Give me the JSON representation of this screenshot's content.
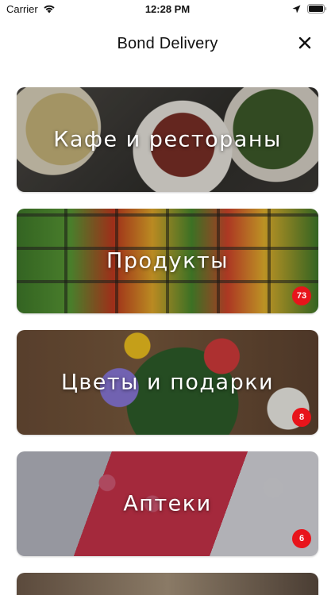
{
  "status_bar": {
    "carrier": "Carrier",
    "time": "12:28 PM"
  },
  "header": {
    "title": "Bond Delivery"
  },
  "categories": [
    {
      "label": "Кафе и рестораны",
      "badge": null
    },
    {
      "label": "Продукты",
      "badge": "73"
    },
    {
      "label": "Цветы и подарки",
      "badge": "8"
    },
    {
      "label": "Аптеки",
      "badge": "6"
    },
    {
      "label": "",
      "badge": null
    }
  ],
  "colors": {
    "badge": "#e8141b",
    "text": "#111111"
  },
  "icons": {
    "wifi": "wifi-icon",
    "location": "location-arrow-icon",
    "battery": "battery-icon",
    "close": "close-icon"
  }
}
